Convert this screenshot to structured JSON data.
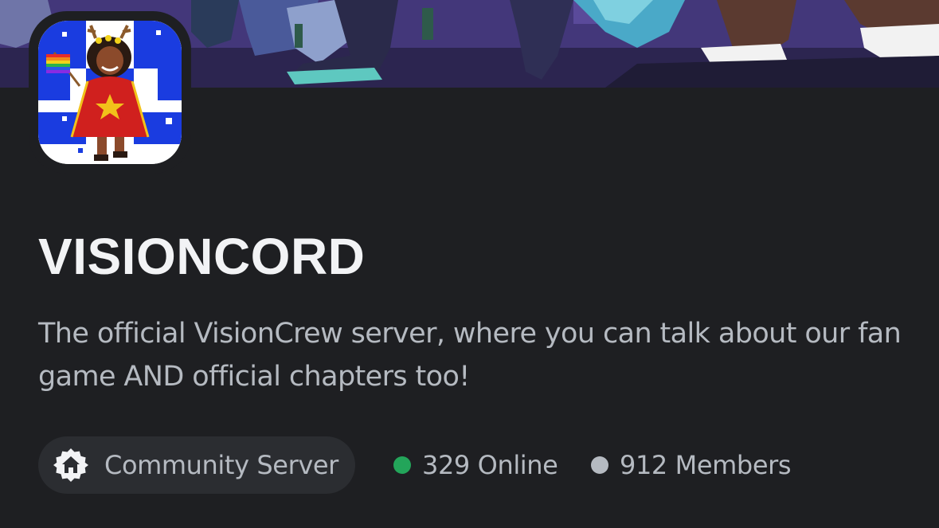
{
  "server": {
    "name": "VISIONCORD",
    "description": "The official VisionCrew server, where you can talk about our fan game AND official chapters too!",
    "community_label": "Community Server",
    "online": "329 Online",
    "members": "912 Members"
  },
  "icons": {
    "community": "home-badge-icon",
    "online_status": "green-dot",
    "members_status": "gray-dot"
  },
  "colors": {
    "background": "#1e1f22",
    "chip_background": "#2b2d31",
    "title": "#f2f3f5",
    "muted_text": "#b5bac1",
    "online_green": "#23a55a",
    "banner_purple": "#3a2f68"
  }
}
